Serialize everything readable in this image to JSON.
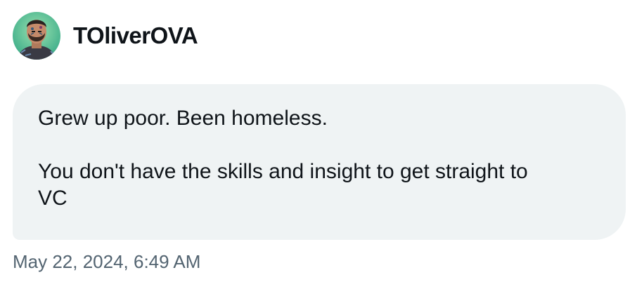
{
  "header": {
    "username": "TOliverOVA",
    "avatar_icon": "profile-avatar-icon"
  },
  "message": {
    "paragraph1": "Grew up poor. Been homeless.",
    "paragraph2_line1": "You don't have the skills and insight to get straight to",
    "paragraph2_line2": "VC"
  },
  "timestamp": "May 22, 2024, 6:49 AM",
  "colors": {
    "bubble_bg": "#eff3f4",
    "text": "#0f1419",
    "muted": "#536471"
  }
}
